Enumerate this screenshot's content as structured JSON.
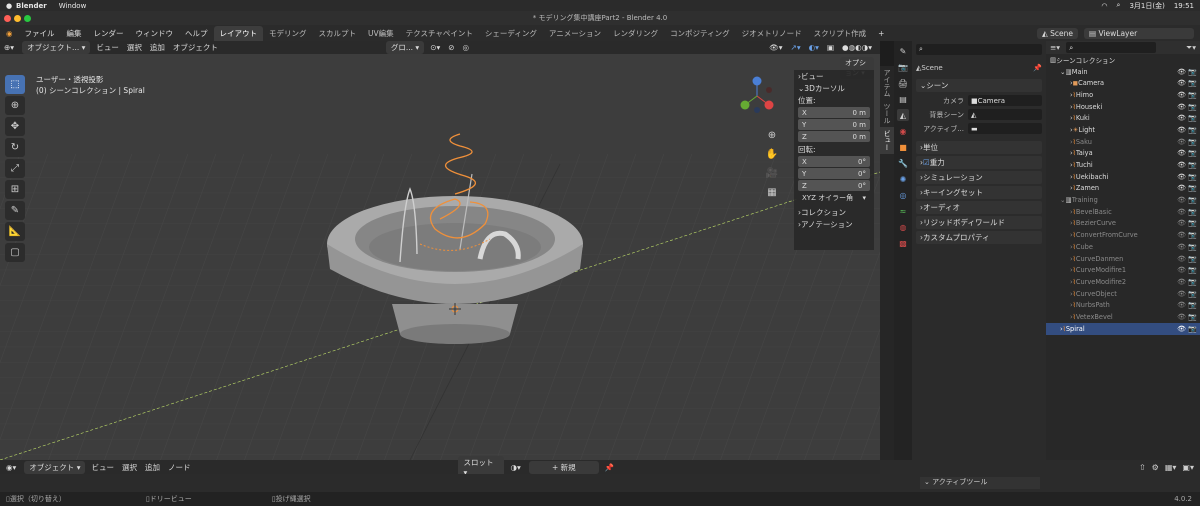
{
  "mac_menu": {
    "app": "Blender",
    "window": "Window",
    "date": "3月1日(金)",
    "time": "19:51"
  },
  "window_title": "* モデリング集中講座Part2 - Blender 4.0",
  "menus": [
    "ファイル",
    "編集",
    "レンダー",
    "ウィンドウ",
    "ヘルプ"
  ],
  "workspace_tabs": [
    {
      "label": "レイアウト",
      "active": true
    },
    {
      "label": "モデリング"
    },
    {
      "label": "スカルプト"
    },
    {
      "label": "UV編集"
    },
    {
      "label": "テクスチャペイント"
    },
    {
      "label": "シェーディング"
    },
    {
      "label": "アニメーション"
    },
    {
      "label": "レンダリング"
    },
    {
      "label": "コンポジティング"
    },
    {
      "label": "ジオメトリノード"
    },
    {
      "label": "スクリプト作成"
    }
  ],
  "scene_selector": "Scene",
  "viewlayer": "ViewLayer",
  "viewport": {
    "mode": "オブジェクト...",
    "menus": [
      "ビュー",
      "選択",
      "追加",
      "オブジェクト"
    ],
    "transform_orient": "グロ...",
    "options": "オプション",
    "overlay_line1": "ユーザー・透視投影",
    "overlay_line2": "(0) シーンコレクション | Spiral"
  },
  "sidepanel": {
    "view": "ビュー",
    "cursor": "3Dカーソル",
    "location": "位置:",
    "rotation": "回転:",
    "loc": [
      {
        "axis": "X",
        "val": "0 m"
      },
      {
        "axis": "Y",
        "val": "0 m"
      },
      {
        "axis": "Z",
        "val": "0 m"
      }
    ],
    "rot": [
      {
        "axis": "X",
        "val": "0°"
      },
      {
        "axis": "Y",
        "val": "0°"
      },
      {
        "axis": "Z",
        "val": "0°"
      }
    ],
    "euler": "XYZ オイラー角",
    "collection": "コレクション",
    "annotation": "アノテーション"
  },
  "ntabs": [
    "アイテム",
    "ツール",
    "ビュー"
  ],
  "props": {
    "scene_name": "Scene",
    "scene": "シーン",
    "camera_label": "カメラ",
    "camera_val": "Camera",
    "bg_scene": "背景シーン",
    "active_clip": "アクティブ...",
    "sections": [
      "単位",
      "重力",
      "シミュレーション",
      "キーイングセット",
      "オーディオ",
      "リジッドボディワールド",
      "カスタムプロパティ"
    ]
  },
  "outliner": {
    "root": "シーンコレクション",
    "rows": [
      {
        "label": "Main",
        "kind": "collection",
        "indent": 1
      },
      {
        "label": "Camera",
        "kind": "camera",
        "indent": 2
      },
      {
        "label": "Himo",
        "kind": "curve",
        "indent": 2
      },
      {
        "label": "Houseki",
        "kind": "curve",
        "indent": 2
      },
      {
        "label": "Kuki",
        "kind": "curve",
        "indent": 2
      },
      {
        "label": "Light",
        "kind": "light",
        "indent": 2
      },
      {
        "label": "Saku",
        "kind": "curve",
        "indent": 2,
        "dim": true
      },
      {
        "label": "Taiya",
        "kind": "curve",
        "indent": 2
      },
      {
        "label": "Tuchi",
        "kind": "curve",
        "indent": 2
      },
      {
        "label": "Uekibachi",
        "kind": "curve",
        "indent": 2
      },
      {
        "label": "Zamen",
        "kind": "curve",
        "indent": 2
      },
      {
        "label": "Training",
        "kind": "collection",
        "indent": 1,
        "dim": true
      },
      {
        "label": "BevelBasic",
        "kind": "curve",
        "indent": 2,
        "dim": true
      },
      {
        "label": "BezierCurve",
        "kind": "curve",
        "indent": 2,
        "dim": true
      },
      {
        "label": "ConvertFromCurve",
        "kind": "curve",
        "indent": 2,
        "dim": true
      },
      {
        "label": "Cube",
        "kind": "curve",
        "indent": 2,
        "dim": true
      },
      {
        "label": "CurveDanmen",
        "kind": "curve",
        "indent": 2,
        "dim": true
      },
      {
        "label": "CurveModifire1",
        "kind": "curve",
        "indent": 2,
        "dim": true
      },
      {
        "label": "CurveModifire2",
        "kind": "curve",
        "indent": 2,
        "dim": true
      },
      {
        "label": "CurveObject",
        "kind": "curve",
        "indent": 2,
        "dim": true
      },
      {
        "label": "NurbsPath",
        "kind": "curve",
        "indent": 2,
        "dim": true
      },
      {
        "label": "VetexBevel",
        "kind": "curve",
        "indent": 2,
        "dim": true
      },
      {
        "label": "Spiral",
        "kind": "curve",
        "indent": 1,
        "selected": true
      }
    ]
  },
  "bottom": {
    "mode": "オブジェクト",
    "menus": [
      "ビュー",
      "選択",
      "追加",
      "ノード"
    ],
    "slot": "スロット",
    "new": "新規",
    "active_tool": "アクティブツール"
  },
  "status": {
    "select": "選択（切り替え）",
    "dolly": "ドリービュー",
    "lasso": "投げ縄選択",
    "version": "4.0.2"
  }
}
